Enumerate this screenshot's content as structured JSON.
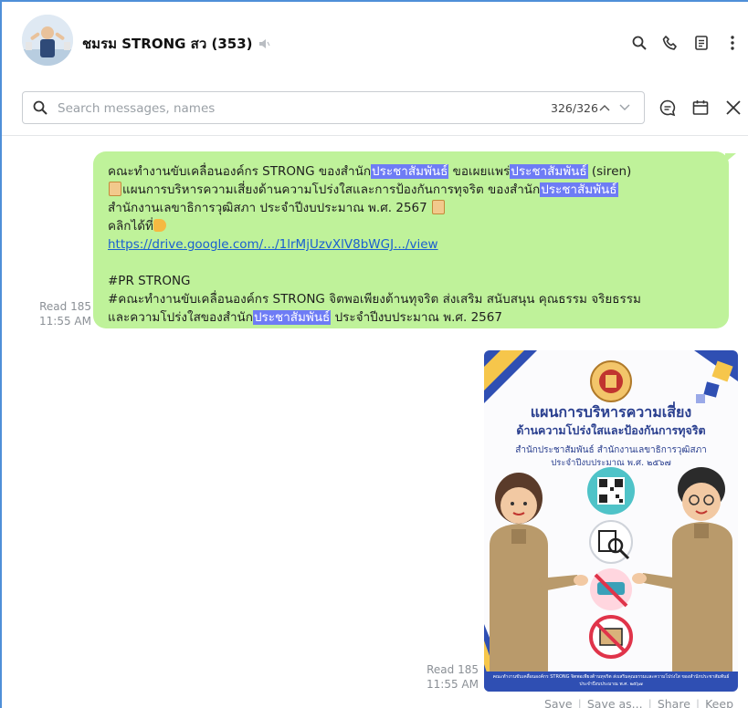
{
  "header": {
    "room_name": "ชมรม STRONG สว (353)",
    "icons": [
      "search-icon",
      "phone-icon",
      "notes-icon",
      "more-icon"
    ]
  },
  "search": {
    "placeholder": "Search messages, names",
    "value": "",
    "counter": "326/326"
  },
  "message": {
    "line1_pre": "คณะทำงานขับเคลื่อนองค์กร STRONG ของสำนัก",
    "highlight": "ประชาสัมพันธ์",
    "line1_mid": " ขอเผยแพร่",
    "line1_post": " (siren)",
    "line2_pre": "แผนการบริหารความเสี่ยงด้านความโปร่งใสและการป้องกันการทุจริต ของสำนัก",
    "line3": "สำนักงานเลขาธิการวุฒิสภา ประจำปีงบประมาณ พ.ศ. 2567",
    "line4": "คลิกได้ที่",
    "link": "https://drive.google.com/.../1lrMjUzvXlV8bWGJ.../view",
    "line6": "#PR STRONG",
    "line7": "#คณะทำงานขับเคลื่อนองค์กร STRONG จิตพอเพียงต้านทุจริต ส่งเสริม สนับสนุน คุณธรรม จริยธรรม",
    "line8_pre": "และความโปร่งใสของสำนัก",
    "line8_post": " ประจำปีงบประมาณ พ.ศ. 2567",
    "read": "Read 185",
    "time": "11:55 AM"
  },
  "image_message": {
    "title1": "แผนการบริหารความเสี่ยง",
    "title2": "ด้านความโปร่งใสและป้องกันการทุจริต",
    "subtitle1": "สำนักประชาสัมพันธ์ สำนักงานเลขาธิการวุฒิสภา",
    "subtitle2": "ประจำปีงบประมาณ พ.ศ. ๒๕๖๗",
    "footer": "คณะทำงานขับเคลื่อนองค์กร STRONG จิตพอเพียงต้านทุจริต ส่งเสริมคุณธรรมและความโปร่งใส ของสำนักประชาสัมพันธ์ ประจำปีงบประมาณ พ.ศ. ๒๕๖๗",
    "read": "Read 185",
    "time": "11:55 AM",
    "actions": [
      "Save",
      "Save as...",
      "Share",
      "Keep"
    ]
  },
  "colors": {
    "bubble": "#bff29a",
    "highlight": "#6e7cf5",
    "link": "#1a5fd0",
    "poster_blue": "#2f4fb3",
    "uniform": "#b99a6b"
  }
}
